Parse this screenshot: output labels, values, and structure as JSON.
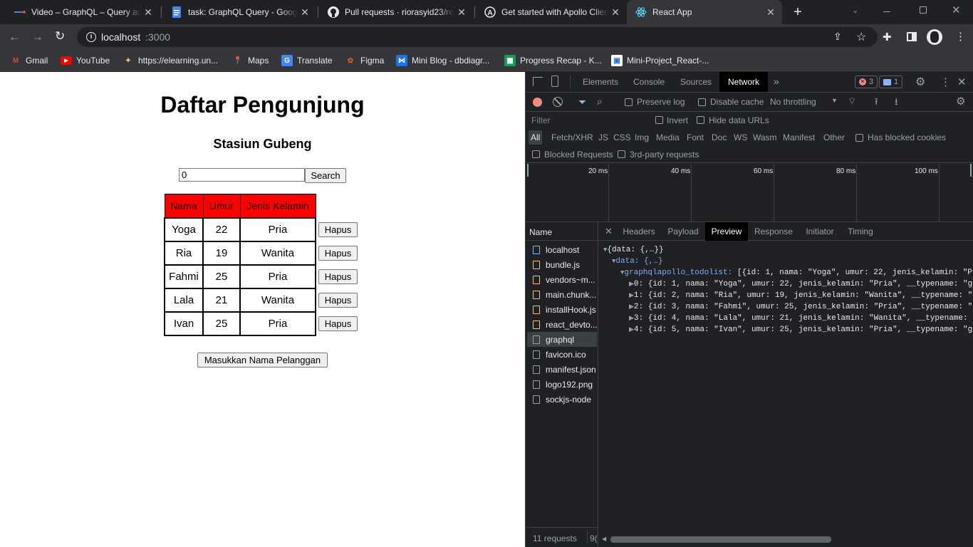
{
  "browser": {
    "tabs": [
      {
        "title": "Video – GraphQL – Query and",
        "active": false,
        "icon": "video-icon"
      },
      {
        "title": "task: GraphQL Query - Google",
        "active": false,
        "icon": "google-docs-icon"
      },
      {
        "title": "Pull requests · riorasyid23/re",
        "active": false,
        "icon": "github-icon"
      },
      {
        "title": "Get started with Apollo Client",
        "active": false,
        "icon": "apollo-icon"
      },
      {
        "title": "React App",
        "active": true,
        "icon": "react-icon"
      }
    ],
    "new_tab": "+",
    "url_host": "localhost",
    "url_port": ":3000",
    "bookmarks": [
      {
        "label": "Gmail",
        "icon": "gmail-icon"
      },
      {
        "label": "YouTube",
        "icon": "youtube-icon"
      },
      {
        "label": "https://elearning.un...",
        "icon": "elearning-icon"
      },
      {
        "label": "Maps",
        "icon": "maps-icon"
      },
      {
        "label": "Translate",
        "icon": "translate-icon"
      },
      {
        "label": "Figma",
        "icon": "figma-icon"
      },
      {
        "label": "Mini Blog - dbdiagr...",
        "icon": "dbdiagram-icon"
      },
      {
        "label": "Progress Recap - K...",
        "icon": "sheets-icon"
      },
      {
        "label": "Mini-Project_React-...",
        "icon": "notion-icon"
      }
    ]
  },
  "app": {
    "title": "Daftar Pengunjung",
    "subtitle": "Stasiun Gubeng",
    "search_value": "0",
    "search_button": "Search",
    "table_headers": [
      "Nama",
      "Umur",
      "Jenis Kelamin"
    ],
    "rows": [
      {
        "nama": "Yoga",
        "umur": "22",
        "jk": "Pria",
        "action": "Hapus"
      },
      {
        "nama": "Ria",
        "umur": "19",
        "jk": "Wanita",
        "action": "Hapus"
      },
      {
        "nama": "Fahmi",
        "umur": "25",
        "jk": "Pria",
        "action": "Hapus"
      },
      {
        "nama": "Lala",
        "umur": "21",
        "jk": "Wanita",
        "action": "Hapus"
      },
      {
        "nama": "Ivan",
        "umur": "25",
        "jk": "Pria",
        "action": "Hapus"
      }
    ],
    "add_button": "Masukkan Nama Pelanggan"
  },
  "devtools": {
    "panels": [
      "Elements",
      "Console",
      "Sources",
      "Network"
    ],
    "active_panel": "Network",
    "errors": "3",
    "messages": "1",
    "preserve_log": "Preserve log",
    "disable_cache": "Disable cache",
    "throttling": "No throttling",
    "filter_placeholder": "Filter",
    "invert": "Invert",
    "hide_data_urls": "Hide data URLs",
    "type_filters": [
      "All",
      "Fetch/XHR",
      "JS",
      "CSS",
      "Img",
      "Media",
      "Font",
      "Doc",
      "WS",
      "Wasm",
      "Manifest",
      "Other"
    ],
    "has_blocked_cookies": "Has blocked cookies",
    "blocked_requests": "Blocked Requests",
    "third_party": "3rd-party requests",
    "timeline_ticks": [
      "20 ms",
      "40 ms",
      "60 ms",
      "80 ms",
      "100 ms"
    ],
    "name_header": "Name",
    "requests": [
      {
        "name": "localhost",
        "type": "doc"
      },
      {
        "name": "bundle.js",
        "type": "js"
      },
      {
        "name": "vendors~m...",
        "type": "js"
      },
      {
        "name": "main.chunk...",
        "type": "js"
      },
      {
        "name": "installHook.js",
        "type": "js"
      },
      {
        "name": "react_devto...",
        "type": "js"
      },
      {
        "name": "graphql",
        "type": "fetch"
      },
      {
        "name": "favicon.ico",
        "type": "other"
      },
      {
        "name": "manifest.json",
        "type": "other"
      },
      {
        "name": "logo192.png",
        "type": "other"
      },
      {
        "name": "sockjs-node",
        "type": "other"
      }
    ],
    "selected_request": "graphql",
    "detail_tabs": [
      "Headers",
      "Payload",
      "Preview",
      "Response",
      "Initiator",
      "Timing"
    ],
    "active_detail_tab": "Preview",
    "status_bar": "11 requests",
    "status_bar_2": "9(",
    "preview": {
      "root": "{data: {,…}}",
      "data_line": "data: {,…}",
      "list_key": "graphqlapollo_todolist",
      "list_summary": "[{id: 1, nama: \"Yoga\", umur: 22, jenis_kelamin: \"P",
      "items": [
        "0: {id: 1, nama: \"Yoga\", umur: 22, jenis_kelamin: \"Pria\", __typename: \"g",
        "1: {id: 2, nama: \"Ria\", umur: 19, jenis_kelamin: \"Wanita\", __typename: \"",
        "2: {id: 3, nama: \"Fahmi\", umur: 25, jenis_kelamin: \"Pria\", __typename: \"",
        "3: {id: 4, nama: \"Lala\", umur: 21, jenis_kelamin: \"Wanita\", __typename: ",
        "4: {id: 5, nama: \"Ivan\", umur: 25, jenis_kelamin: \"Pria\", __typename: \"g"
      ]
    }
  }
}
